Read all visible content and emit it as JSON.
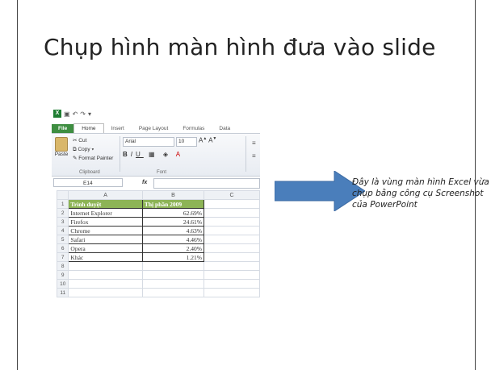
{
  "slide": {
    "title": "Chụp hình màn hình đưa vào slide",
    "note": "Đây là vùng màn hình Excel vừa chụp bằng công cụ Screenshot của PowerPoint"
  },
  "excel": {
    "tabs": [
      "File",
      "Home",
      "Insert",
      "Page Layout",
      "Formulas",
      "Data"
    ],
    "active_tab": "Home",
    "clipboard": {
      "paste": "Paste",
      "cut": "Cut",
      "copy": "Copy",
      "format_painter": "Format Painter",
      "group": "Clipboard"
    },
    "font": {
      "name": "Arial",
      "size": "10",
      "group": "Font"
    },
    "name_box": "E14",
    "fx": "fx",
    "columns": [
      "A",
      "B",
      "C"
    ],
    "rows": [
      {
        "n": "1",
        "a": "Trình duyệt",
        "b": "Thị phần 2009"
      },
      {
        "n": "2",
        "a": "Internet Explorer",
        "b": "62.69%"
      },
      {
        "n": "3",
        "a": "Firefox",
        "b": "24.61%"
      },
      {
        "n": "4",
        "a": "Chrome",
        "b": "4.63%"
      },
      {
        "n": "5",
        "a": "Safari",
        "b": "4.46%"
      },
      {
        "n": "6",
        "a": "Opera",
        "b": "2.40%"
      },
      {
        "n": "7",
        "a": "Khác",
        "b": "1.21%"
      },
      {
        "n": "8",
        "a": "",
        "b": ""
      },
      {
        "n": "9",
        "a": "",
        "b": ""
      },
      {
        "n": "10",
        "a": "",
        "b": ""
      },
      {
        "n": "11",
        "a": "",
        "b": ""
      }
    ]
  },
  "colors": {
    "header_green": "#8db456",
    "arrow_blue": "#4a7ebb",
    "file_tab": "#3e8e41"
  }
}
